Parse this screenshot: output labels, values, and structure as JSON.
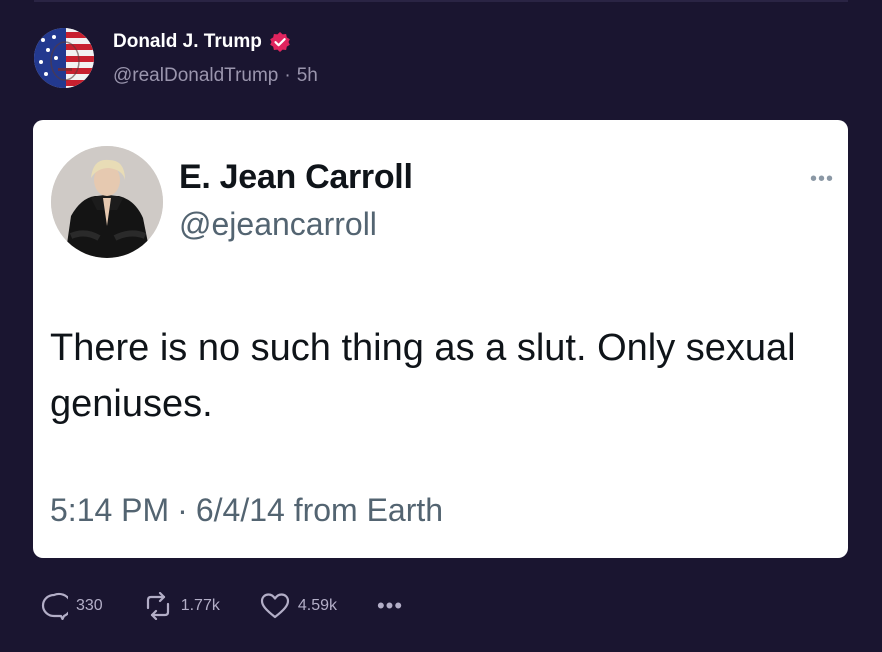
{
  "post": {
    "author_name": "Donald J. Trump",
    "handle": "@realDonaldTrump",
    "separator": "·",
    "time_ago": "5h"
  },
  "quote": {
    "name": "E. Jean Carroll",
    "handle": "@ejeancarroll",
    "more_label": "•••",
    "text": "There is no such thing as a slut. Only sexual geniuses.",
    "time": "5:14 PM",
    "separator": "·",
    "date": "6/4/14 from Earth"
  },
  "actions": {
    "replies": "330",
    "reposts": "1.77k",
    "likes": "4.59k",
    "more_label": "•••"
  },
  "colors": {
    "background": "#1a1530",
    "verified_badge": "#e0245e",
    "card": "#ffffff",
    "muted_text": "#536471"
  },
  "icons": {
    "reply": "reply-icon",
    "repost": "repost-icon",
    "like": "heart-icon",
    "more": "more-icon",
    "verified": "verified-badge-icon"
  }
}
